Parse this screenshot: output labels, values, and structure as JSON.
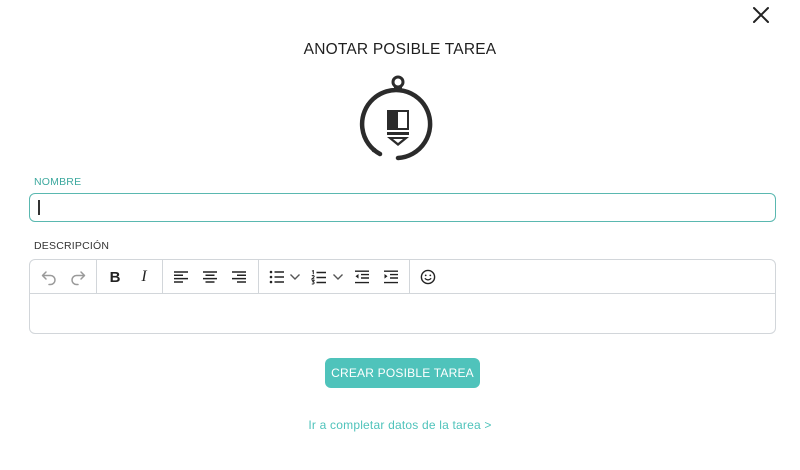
{
  "dialog": {
    "title": "ANOTAR POSIBLE TAREA"
  },
  "form": {
    "name_label": "NOMBRE",
    "name_value": "",
    "description_label": "DESCRIPCIÓN",
    "description_value": ""
  },
  "toolbar": {
    "buttons": [
      "undo-icon",
      "redo-icon",
      "bold-icon",
      "italic-icon",
      "align-left-icon",
      "align-center-icon",
      "align-right-icon",
      "bullet-list-icon",
      "chevron-down-icon",
      "numbered-list-icon",
      "chevron-down-icon",
      "outdent-icon",
      "indent-icon",
      "emoji-icon"
    ],
    "bold_glyph": "B",
    "italic_glyph": "I"
  },
  "actions": {
    "create_label": "CREAR POSIBLE TAREA",
    "complete_link": "Ir a completar datos de la tarea >"
  },
  "colors": {
    "accent": "#4fc3bb",
    "label_accent": "#3ea99f",
    "input_border": "#5ab8b0",
    "icon": "#2b2b2b"
  }
}
